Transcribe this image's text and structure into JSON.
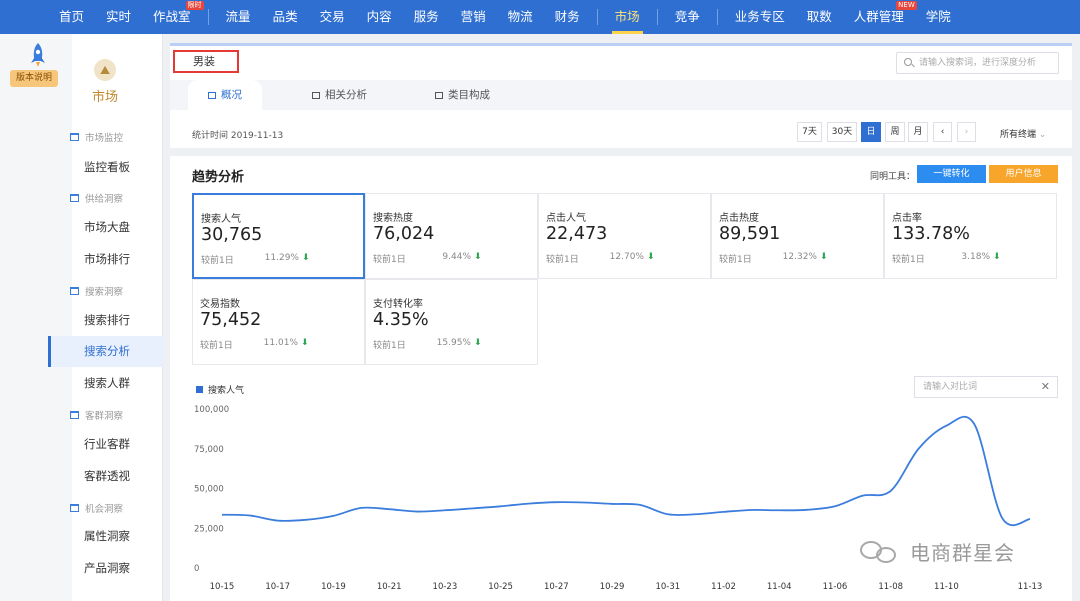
{
  "nav": {
    "items": [
      {
        "label": "首页"
      },
      {
        "label": "实时"
      },
      {
        "label": "作战室",
        "badge": "限时"
      },
      {
        "label": "流量"
      },
      {
        "label": "品类"
      },
      {
        "label": "交易"
      },
      {
        "label": "内容"
      },
      {
        "label": "服务"
      },
      {
        "label": "营销"
      },
      {
        "label": "物流"
      },
      {
        "label": "财务"
      },
      {
        "label": "市场",
        "active": true
      },
      {
        "label": "竞争"
      },
      {
        "label": "业务专区"
      },
      {
        "label": "取数"
      },
      {
        "label": "人群管理",
        "badge": "NEW"
      },
      {
        "label": "学院"
      }
    ]
  },
  "sidebar": {
    "version_tag": "版本说明",
    "module_label": "市场",
    "groups": [
      {
        "label": "市场监控",
        "items": [
          "监控看板"
        ]
      },
      {
        "label": "供给洞察",
        "items": [
          "市场大盘",
          "市场排行"
        ]
      },
      {
        "label": "搜索洞察",
        "items": [
          "搜索排行",
          "搜索分析",
          "搜索人群"
        ]
      },
      {
        "label": "客群洞察",
        "items": [
          "行业客群",
          "客群透视"
        ]
      },
      {
        "label": "机会洞察",
        "items": [
          "属性洞察",
          "产品洞察"
        ]
      }
    ],
    "active_item": "搜索分析"
  },
  "header": {
    "keyword": "男装",
    "search_placeholder": "请输入搜索词，进行深度分析",
    "tabs": [
      "概况",
      "相关分析",
      "类目构成"
    ],
    "stat_time": "统计时间 2019-11-13",
    "ranges": [
      "7天",
      "30天",
      "日",
      "周",
      "月"
    ],
    "active_range": "日",
    "prev_label": "‹",
    "next_label": "›",
    "terminal": "所有终端"
  },
  "trend": {
    "title": "趋势分析",
    "tools_label": "同明工具：",
    "convert_btn": "一键转化",
    "user_btn": "用户信息",
    "compare_label": "较前1日",
    "metrics": [
      {
        "label": "搜索人气",
        "value": "30,765",
        "pct": "11.29%",
        "trend": "down"
      },
      {
        "label": "搜索热度",
        "value": "76,024",
        "pct": "9.44%",
        "trend": "down"
      },
      {
        "label": "点击人气",
        "value": "22,473",
        "pct": "12.70%",
        "trend": "down"
      },
      {
        "label": "点击热度",
        "value": "89,591",
        "pct": "12.32%",
        "trend": "down"
      },
      {
        "label": "点击率",
        "value": "133.78%",
        "pct": "3.18%",
        "trend": "down"
      },
      {
        "label": "交易指数",
        "value": "75,452",
        "pct": "11.01%",
        "trend": "down"
      },
      {
        "label": "支付转化率",
        "value": "4.35%",
        "pct": "15.95%",
        "trend": "down"
      }
    ],
    "compare_placeholder": "请输入对比词",
    "close_label": "✕"
  },
  "chart_data": {
    "type": "line",
    "title": "",
    "xlabel": "",
    "ylabel": "",
    "ylim": [
      0,
      100000
    ],
    "yticks": [
      "0",
      "25,000",
      "50,000",
      "75,000",
      "100,000"
    ],
    "xticks": [
      "10-15",
      "10-17",
      "10-19",
      "10-21",
      "10-23",
      "10-25",
      "10-27",
      "10-29",
      "10-31",
      "11-02",
      "11-04",
      "11-06",
      "11-08",
      "11-10",
      "11-13"
    ],
    "x": [
      "10-15",
      "10-16",
      "10-17",
      "10-18",
      "10-19",
      "10-20",
      "10-21",
      "10-22",
      "10-23",
      "10-24",
      "10-25",
      "10-26",
      "10-27",
      "10-28",
      "10-29",
      "10-30",
      "10-31",
      "11-01",
      "11-02",
      "11-03",
      "11-04",
      "11-05",
      "11-06",
      "11-07",
      "11-08",
      "11-09",
      "11-10",
      "11-11",
      "11-12",
      "11-13"
    ],
    "series": [
      {
        "name": "搜索人气",
        "color": "#3b7ddd",
        "values": [
          33500,
          33000,
          29800,
          30300,
          32800,
          37800,
          37000,
          35500,
          36300,
          37500,
          38800,
          40500,
          41400,
          41200,
          40300,
          39700,
          33800,
          33800,
          35300,
          36500,
          36300,
          36600,
          38800,
          45500,
          48500,
          75000,
          89500,
          90500,
          31500,
          30765
        ]
      }
    ],
    "grid": false,
    "legend": "top-left"
  },
  "watermark": "电商群星会"
}
